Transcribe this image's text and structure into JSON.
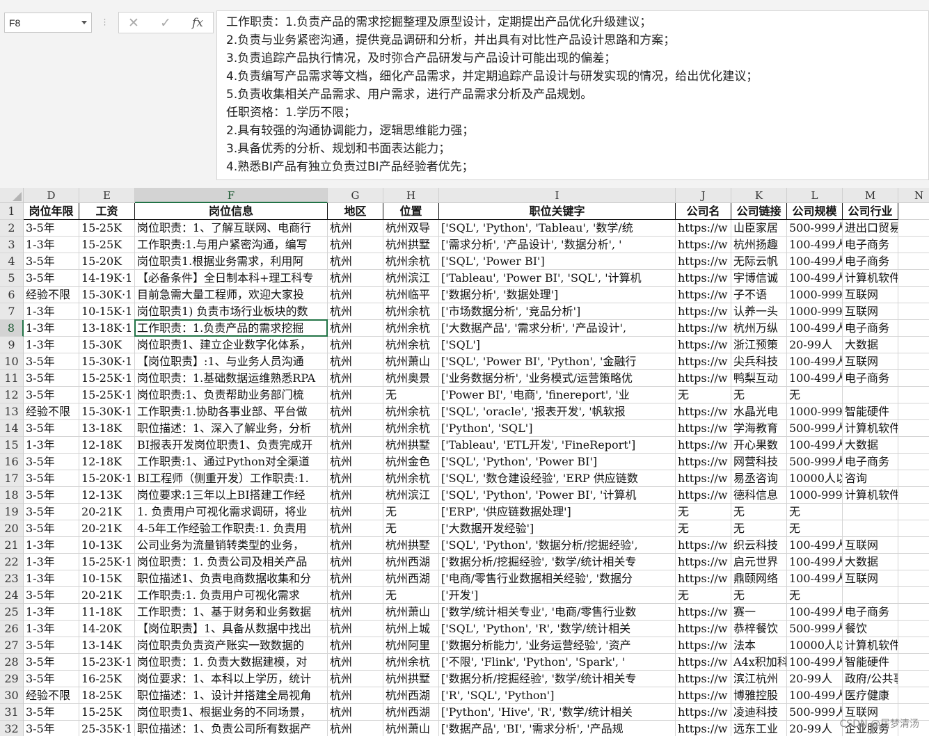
{
  "name_box": {
    "value": "F8"
  },
  "formula_bar": {
    "cancel_icon": "x-icon",
    "enter_icon": "check-icon",
    "fx_label": "fx",
    "content_lines": [
      "工作职责：1.负责产品的需求挖掘整理及原型设计，定期提出产品优化升级建议；",
      "2.负责与业务紧密沟通，提供竞品调研和分析，并出具有对比性产品设计思路和方案；",
      "3.负责追踪产品执行情况，及时弥合产品研发与产品设计可能出现的偏差；",
      "4.负责编写产品需求等文档，细化产品需求，并定期追踪产品设计与研发实现的情况，给出优化建议；",
      "5.负责收集相关产品需求、用户需求，进行产品需求分析及产品规划。",
      "任职资格：1.学历不限；",
      "2.具有较强的沟通协调能力，逻辑思维能力强；",
      "3.具备优秀的分析、规划和书面表达能力；",
      "4.熟悉BI产品有独立负责过BI产品经验者优先；"
    ]
  },
  "columns": [
    "D",
    "E",
    "F",
    "G",
    "H",
    "I",
    "J",
    "K",
    "L",
    "M",
    "N"
  ],
  "selected_column": "F",
  "selected_row": "8",
  "header_row": {
    "number": "1",
    "cells": [
      "岗位年限",
      "工资",
      "岗位信息",
      "地区",
      "位置",
      "职位关键字",
      "公司名",
      "公司链接",
      "公司规模",
      "公司行业",
      ""
    ]
  },
  "rows": [
    {
      "n": "2",
      "c": [
        "3-5年",
        "15-25K",
        "岗位职责：1、了解互联网、电商行",
        "杭州",
        "杭州双导",
        "['SQL', 'Python', 'Tableau', '数学/统",
        "https://w",
        "山臣家居",
        "500-999人",
        "进出口贸易",
        ""
      ]
    },
    {
      "n": "3",
      "c": [
        "1-3年",
        "15-25K",
        "工作职责:1.与用户紧密沟通，编写",
        "杭州",
        "杭州拱墅",
        "['需求分析', '产品设计', '数据分析', '",
        "https://w",
        "杭州扬趣",
        "100-499人",
        "电子商务",
        ""
      ]
    },
    {
      "n": "4",
      "c": [
        "3-5年",
        "15-20K",
        "岗位职责1.根据业务需求，利用阿",
        "杭州",
        "杭州余杭",
        "['SQL', 'Power BI']",
        "https://w",
        "无际云帆",
        "100-499人",
        "电子商务",
        ""
      ]
    },
    {
      "n": "5",
      "c": [
        "3-5年",
        "14-19K·1",
        "【必备条件】全日制本科+理工科专",
        "杭州",
        "杭州滨江",
        "['Tableau', 'Power BI', 'SQL', '计算机",
        "https://w",
        "宇博信诚",
        "100-499人",
        "计算机软件",
        ""
      ]
    },
    {
      "n": "6",
      "c": [
        "经验不限",
        "15-30K·1",
        "目前急需大量工程师，欢迎大家投",
        "杭州",
        "杭州临平",
        "['数据分析', '数据处理']",
        "https://w",
        "子不语",
        "1000-9999人",
        "互联网",
        ""
      ]
    },
    {
      "n": "7",
      "c": [
        "1-3年",
        "10-15K·1",
        "岗位职责1) 负责市场行业板块的数",
        "杭州",
        "杭州余杭",
        "['市场数据分析', '竞品分析']",
        "https://w",
        "认养一头",
        "1000-9999人",
        "互联网",
        ""
      ]
    },
    {
      "n": "8",
      "c": [
        "1-3年",
        "13-18K·1",
        "工作职责：1.负责产品的需求挖掘",
        "杭州",
        "杭州余杭",
        "['大数据产品', '需求分析', '产品设计',",
        "https://w",
        "杭州万纵",
        "100-499人",
        "电子商务",
        ""
      ]
    },
    {
      "n": "9",
      "c": [
        "1-3年",
        "15-30K",
        "岗位职责1、建立企业数字化体系，",
        "杭州",
        "杭州余杭",
        "['SQL']",
        "https://w",
        "浙江预策",
        "20-99人",
        "大数据",
        ""
      ]
    },
    {
      "n": "10",
      "c": [
        "3-5年",
        "15-30K·1",
        "【岗位职责】:1、与业务人员沟通",
        "杭州",
        "杭州萧山",
        "['SQL', 'Power BI', 'Python', '金融行",
        "https://w",
        "尖兵科技",
        "100-499人",
        "互联网",
        ""
      ]
    },
    {
      "n": "11",
      "c": [
        "3-5年",
        "15-25K·1",
        "岗位职责：1.基础数据运维熟悉RPA",
        "杭州",
        "杭州奥景",
        "['业务数据分析', '业务模式/运营策略优",
        "https://w",
        "鸭梨互动",
        "100-499人",
        "电子商务",
        ""
      ]
    },
    {
      "n": "12",
      "c": [
        "3-5年",
        "15-25K·1",
        "岗位职责:1、负责帮助业务部门梳",
        "杭州",
        "无",
        "['Power BI', '电商', 'finereport', '业",
        "无",
        "无",
        "无",
        "",
        ""
      ]
    },
    {
      "n": "13",
      "c": [
        "经验不限",
        "15-30K·1",
        "工作职责:1.协助各事业部、平台做",
        "杭州",
        "杭州余杭",
        "['SQL', 'oracle', '报表开发', '帆软报",
        "https://w",
        "水晶光电",
        "1000-9999人",
        "智能硬件",
        ""
      ]
    },
    {
      "n": "14",
      "c": [
        "3-5年",
        "13-18K",
        "职位描述：1、深入了解业务，分析",
        "杭州",
        "杭州余杭",
        "['Python', 'SQL']",
        "https://w",
        "学海教育",
        "500-999人",
        "计算机软件",
        ""
      ]
    },
    {
      "n": "15",
      "c": [
        "1-3年",
        "12-18K",
        "BI报表开发岗位职责1、负责完成开",
        "杭州",
        "杭州拱墅",
        "['Tableau', 'ETL开发', 'FineReport']",
        "https://w",
        "开心果数",
        "100-499人",
        "大数据",
        ""
      ]
    },
    {
      "n": "16",
      "c": [
        "3-5年",
        "12-18K",
        "工作职责:1、通过Python对全渠道",
        "杭州",
        "杭州金色",
        "['SQL', 'Python', 'Power BI']",
        "https://w",
        "网营科技",
        "500-999人",
        "电子商务",
        ""
      ]
    },
    {
      "n": "17",
      "c": [
        "3-5年",
        "15-20K·1",
        "BI工程师（侧重开发）工作职责:1.",
        "杭州",
        "杭州余杭",
        "['SQL', '数仓建设经验', 'ERP 供应链数",
        "https://w",
        "易丞咨询",
        "10000人以上",
        "咨询",
        ""
      ]
    },
    {
      "n": "18",
      "c": [
        "3-5年",
        "12-13K",
        "岗位要求:1三年以上BI搭建工作经",
        "杭州",
        "杭州滨江",
        "['SQL', 'Python', 'Power BI', '计算机",
        "https://w",
        "德科信息",
        "1000-9999人",
        "计算机软件",
        ""
      ]
    },
    {
      "n": "19",
      "c": [
        "3-5年",
        "20-21K",
        "1. 负责用户可视化需求调研，将业",
        "杭州",
        "无",
        "['ERP', '供应链数据处理']",
        "无",
        "无",
        "无",
        "",
        ""
      ]
    },
    {
      "n": "20",
      "c": [
        "3-5年",
        "20-21K",
        "4-5年工作经验工作职责:1. 负责用",
        "杭州",
        "无",
        "['大数据开发经验']",
        "无",
        "无",
        "无",
        "",
        ""
      ]
    },
    {
      "n": "21",
      "c": [
        "1-3年",
        "10-13K",
        "公司业务为流量销转类型的业务，",
        "杭州",
        "杭州拱墅",
        "['SQL', 'Python', '数据分析/挖掘经验',",
        "https://w",
        "织云科技",
        "100-499人",
        "互联网",
        ""
      ]
    },
    {
      "n": "22",
      "c": [
        "1-3年",
        "15-25K·1",
        "岗位职责：1. 负责公司及相关产品",
        "杭州",
        "杭州西湖",
        "['数据分析/挖掘经验', '数学/统计相关专",
        "https://w",
        "启元世界",
        "100-499人",
        "大数据",
        ""
      ]
    },
    {
      "n": "23",
      "c": [
        "1-3年",
        "10-15K",
        "职位描述1、负责电商数据收集和分",
        "杭州",
        "杭州西湖",
        "['电商/零售行业数据相关经验', '数据分",
        "https://w",
        "鼎颐网络",
        "100-499人",
        "互联网",
        ""
      ]
    },
    {
      "n": "24",
      "c": [
        "3-5年",
        "20-21K",
        "工作职责:1. 负责用户可视化需求",
        "杭州",
        "无",
        "['开发']",
        "无",
        "无",
        "无",
        "",
        ""
      ]
    },
    {
      "n": "25",
      "c": [
        "1-3年",
        "11-18K",
        "工作职责：1、基于财务和业务数据",
        "杭州",
        "杭州萧山",
        "['数学/统计相关专业', '电商/零售行业数",
        "https://w",
        "赛一",
        "100-499人",
        "电子商务",
        ""
      ]
    },
    {
      "n": "26",
      "c": [
        "1-3年",
        "14-20K",
        "【岗位职责】1、具备从数据中找出",
        "杭州",
        "杭州上城",
        "['SQL', 'Python', 'R', '数学/统计相关",
        "https://w",
        "恭梓餐饮",
        "500-999人",
        "餐饮",
        ""
      ]
    },
    {
      "n": "27",
      "c": [
        "3-5年",
        "13-14K",
        "岗位职责负责资产账实一致数据的",
        "杭州",
        "杭州阿里",
        "['数据分析能力', '业务运营经验', '资产",
        "https://w",
        "法本",
        "10000人以上",
        "计算机软件",
        ""
      ]
    },
    {
      "n": "28",
      "c": [
        "3-5年",
        "15-23K·1",
        "岗位职责：1. 负责大数据建模，对",
        "杭州",
        "杭州余杭",
        "['不限', 'Flink', 'Python', 'Spark', '",
        "https://w",
        "A4x积加科",
        "100-499人",
        "智能硬件",
        ""
      ]
    },
    {
      "n": "29",
      "c": [
        "3-5年",
        "16-25K",
        "岗位要求：1、本科以上学历，统计",
        "杭州",
        "杭州拱墅",
        "['数据分析/挖掘经验', '数学/统计相关专",
        "https://w",
        "滨江杭州",
        "20-99人",
        "政府/公共事业",
        ""
      ]
    },
    {
      "n": "30",
      "c": [
        "经验不限",
        "18-25K",
        "职位描述：1、设计并搭建全局视角",
        "杭州",
        "杭州西湖",
        "['R', 'SQL', 'Python']",
        "https://w",
        "博雅控股",
        "100-499人",
        "医疗健康",
        ""
      ]
    },
    {
      "n": "31",
      "c": [
        "3-5年",
        "15-25K",
        "岗位职责1、根据业务的不同场景，",
        "杭州",
        "杭州西湖",
        "['Python', 'Hive', 'R', '数学/统计相关",
        "https://w",
        "凌迪科技",
        "500-999人",
        "互联网",
        ""
      ]
    },
    {
      "n": "32",
      "c": [
        "3-5年",
        "25-35K·1",
        "职位描述：1、负责公司所有数据产",
        "杭州",
        "杭州萧山",
        "['数据产品', 'BI', '需求分析', '产品规",
        "https://w",
        "远东工业",
        "20-99人",
        "企业服务",
        ""
      ]
    }
  ],
  "watermark": "CSDN @居梦清汤"
}
